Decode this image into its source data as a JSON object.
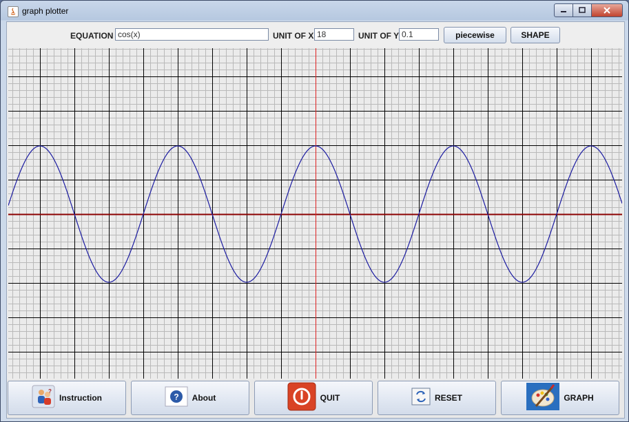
{
  "window": {
    "title": "graph plotter"
  },
  "toolbar": {
    "equation_label": "EQUATION",
    "equation_value": "cos(x)",
    "unit_x_label": "UNIT OF X",
    "unit_x_value": "18",
    "unit_y_label": "UNIT OF Y",
    "unit_y_value": "0.1",
    "piecewise_label": "piecewise",
    "shape_label": "SHAPE"
  },
  "plot": {
    "function": "cos(x)",
    "curve_color": "#1a1aa0",
    "x_axis_color": "#8b0000",
    "y_axis_color": "#e02020",
    "minor_grid_color": "#b9b9b9",
    "major_grid_color": "#000000"
  },
  "buttons": {
    "instruction": "Instruction",
    "about": "About",
    "quit": "QUIT",
    "reset": "RESET",
    "graph": "GRAPH"
  }
}
